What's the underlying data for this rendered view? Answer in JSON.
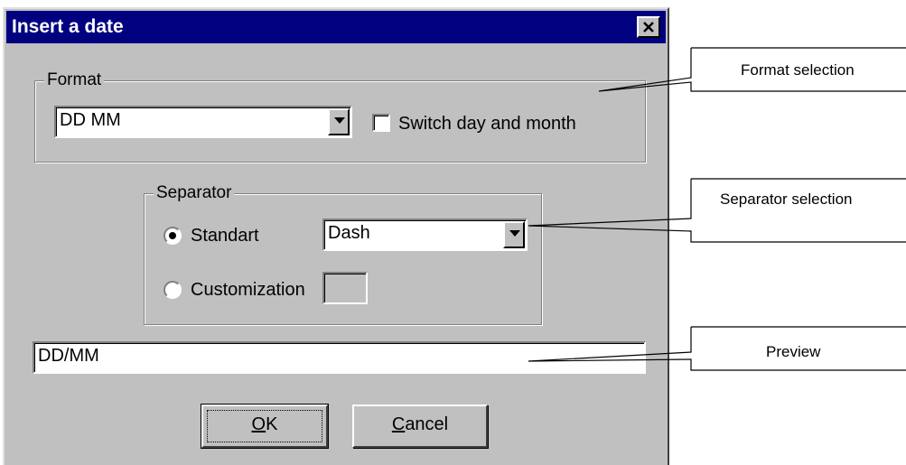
{
  "dialog": {
    "title": "Insert a date",
    "format_group": {
      "legend": "Format",
      "format_value": "DD MM",
      "switch_label": "Switch day and month",
      "switch_checked": false
    },
    "separator_group": {
      "legend": "Separator",
      "standard_label": "Standart",
      "standard_selected": true,
      "standard_value": "Dash",
      "custom_label": "Customization",
      "custom_selected": false,
      "custom_value": ""
    },
    "preview_value": "DD/MM",
    "ok_label_accel": "O",
    "ok_label_rest": "K",
    "cancel_label_accel": "C",
    "cancel_label_rest": "ancel"
  },
  "callouts": {
    "format": "Format selection",
    "separator": "Separator selection",
    "preview": "Preview"
  },
  "colors": {
    "titlebar": "#000080",
    "dialog_face": "#c0c0c0"
  }
}
